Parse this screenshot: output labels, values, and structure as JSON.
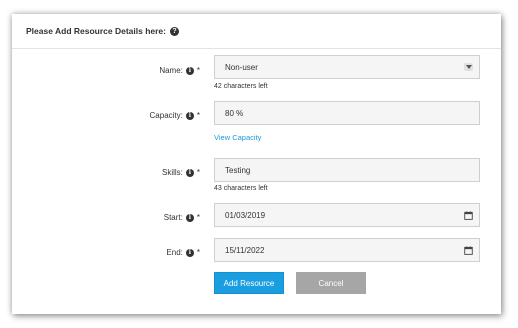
{
  "header": {
    "title": "Please Add Resource Details here:"
  },
  "form": {
    "name": {
      "label": "Name:",
      "required": "*",
      "value": "Non-user",
      "hint": "42 characters left"
    },
    "capacity": {
      "label": "Capacity:",
      "required": "*",
      "value": "80 %",
      "link": "View Capacity"
    },
    "skills": {
      "label": "Skills:",
      "required": "*",
      "value": "Testing",
      "hint": "43 characters left"
    },
    "start": {
      "label": "Start:",
      "required": "*",
      "value": "01/03/2019"
    },
    "end": {
      "label": "End:",
      "required": "*",
      "value": "15/11/2022"
    }
  },
  "buttons": {
    "add": "Add Resource",
    "cancel": "Cancel"
  },
  "colors": {
    "primary": "#1a9ee0",
    "secondary": "#a6a6a6",
    "link": "#1f9ad6"
  },
  "icons": {
    "help": "question-circle-icon",
    "info": "info-circle-icon",
    "dropdown": "chevron-down-icon",
    "calendar": "calendar-icon"
  }
}
